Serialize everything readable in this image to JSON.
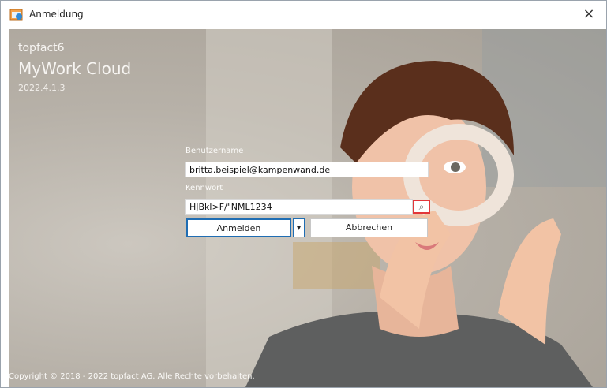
{
  "window": {
    "title": "Anmeldung"
  },
  "brand": {
    "line1": "topfact6",
    "line2": "MyWork Cloud",
    "version": "2022.4.1.3"
  },
  "login": {
    "username_label": "Benutzername",
    "username_value": "britta.beispiel@kampenwand.de",
    "password_label": "Kennwort",
    "password_value": "HJBkl>F/\"NML1234",
    "login_label": "Anmelden",
    "cancel_label": "Abbrechen"
  },
  "footer": {
    "copyright": "Copyright © 2018 - 2022 topfact AG. Alle Rechte vorbehalten."
  },
  "colors": {
    "accent": "#1f6db3",
    "highlight": "#e2363a"
  },
  "icons": {
    "app": "app-icon",
    "close": "close-icon",
    "search": "search-icon",
    "dropdown": "dropdown-arrow-icon"
  }
}
